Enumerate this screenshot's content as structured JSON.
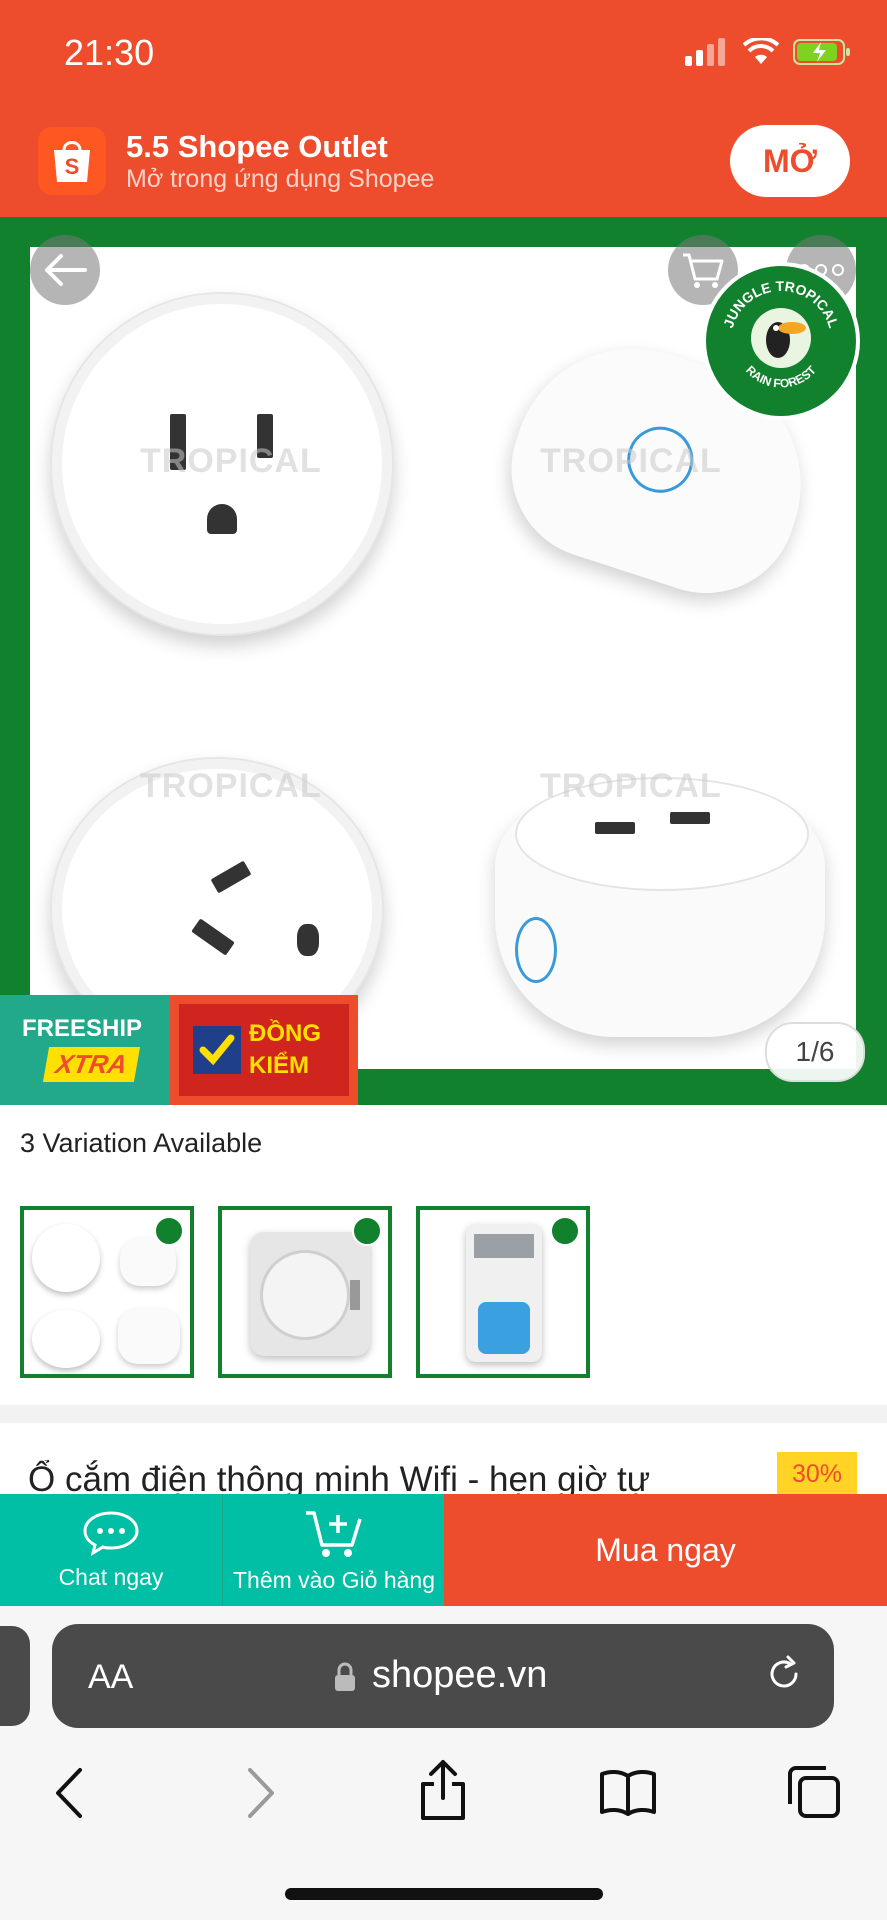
{
  "status_bar": {
    "time": "21:30"
  },
  "banner": {
    "title": "5.5 Shopee Outlet",
    "subtitle": "Mở trong ứng dụng Shopee",
    "open_button": "MỞ"
  },
  "product_image": {
    "watermark": "TROPICAL",
    "badge_text_top": "JUNGLE TROPICAL",
    "badge_text_bottom": "RAIN FOREST",
    "freeship_line1": "FREESHIP",
    "freeship_line2": "XTRA",
    "dongkiem_line1": "ĐỒNG",
    "dongkiem_line2": "KIỂM",
    "counter": "1/6"
  },
  "variations": {
    "label": "3 Variation Available",
    "items": [
      {
        "name": "smart-plug-variant"
      },
      {
        "name": "mechanical-timer-variant"
      },
      {
        "name": "digital-timer-variant"
      }
    ]
  },
  "product": {
    "title": "Ổ cắm điện thông minh Wifi - hẹn giờ tự",
    "discount": "30%"
  },
  "actions": {
    "chat": "Chat ngay",
    "add_to_cart": "Thêm vào Giỏ hàng",
    "buy_now": "Mua ngay"
  },
  "browser": {
    "aa": "AA",
    "url": "shopee.vn"
  },
  "colors": {
    "brand": "#ee4d2d",
    "teal": "#00bfa5",
    "frame_green": "#11812e"
  }
}
